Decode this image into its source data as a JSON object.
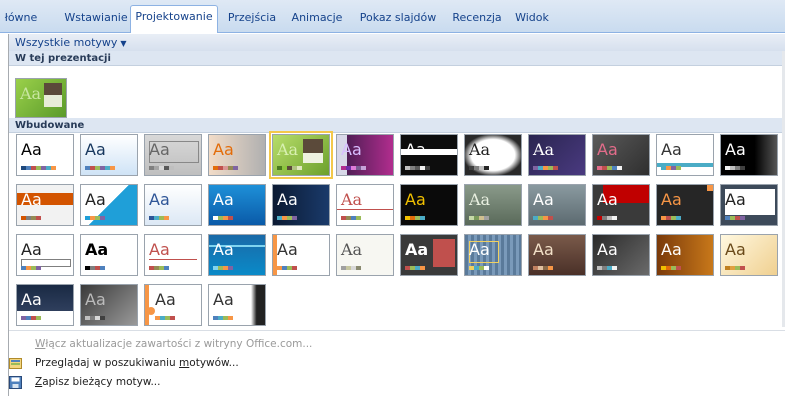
{
  "ribbon": {
    "tabs": [
      {
        "label": "łówne"
      },
      {
        "label": "Wstawianie"
      },
      {
        "label": "Projektowanie"
      },
      {
        "label": "Przejścia"
      },
      {
        "label": "Animacje"
      },
      {
        "label": "Pokaz slajdów"
      },
      {
        "label": "Recenzja"
      },
      {
        "label": "Widok"
      }
    ],
    "active_tab": "Projektowanie"
  },
  "gallery": {
    "filter_label": "Wszystkie motywy",
    "section_presentation": "W tej prezentacji",
    "section_builtin": "Wbudowane",
    "thumb_text": "Aa"
  },
  "menu": {
    "enable_updates": {
      "pre": "",
      "acc": "W",
      "post": "łącz aktualizacje zawartości z witryny Office.com..."
    },
    "browse": {
      "pre": "Przeglądaj w poszukiwaniu ",
      "acc": "m",
      "post": "otywów..."
    },
    "save": {
      "pre": "",
      "acc": "Z",
      "post": "apisz bieżący motyw..."
    }
  },
  "colors": {
    "accent": "#15428b",
    "selection": "#f3c84a"
  }
}
